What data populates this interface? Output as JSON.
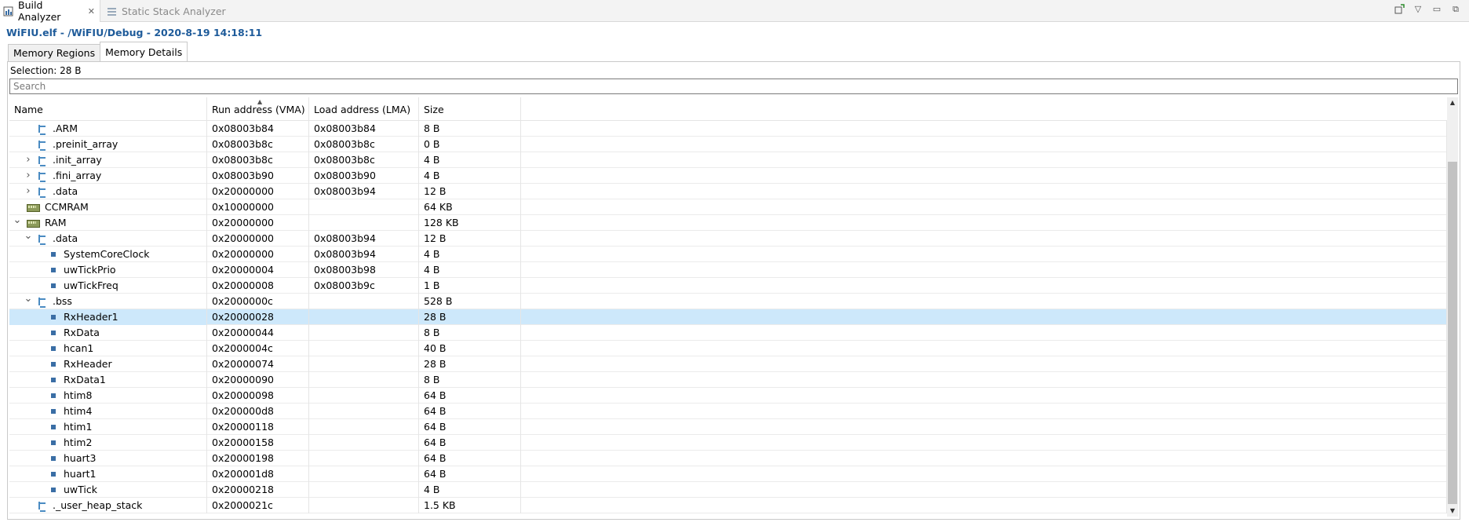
{
  "view_tabs": [
    {
      "label": "Build Analyzer",
      "active": true
    },
    {
      "label": "Static Stack Analyzer",
      "active": false
    }
  ],
  "elf_title": "WiFIU.elf - /WiFIU/Debug - 2020-8-19 14:18:11",
  "inner_tabs": [
    "Memory Regions",
    "Memory Details"
  ],
  "selection_text": "Selection: 28 B",
  "search": {
    "placeholder": "Search",
    "value": ""
  },
  "columns": [
    "Name",
    "Run address (VMA)",
    "Load address (LMA)",
    "Size"
  ],
  "rows": [
    {
      "name": ".ARM",
      "vma": "0x08003b84",
      "lma": "0x08003b84",
      "size": "8 B",
      "depth": 1,
      "twisty": "",
      "icon": "section"
    },
    {
      "name": ".preinit_array",
      "vma": "0x08003b8c",
      "lma": "0x08003b8c",
      "size": "0 B",
      "depth": 1,
      "twisty": "",
      "icon": "section"
    },
    {
      "name": ".init_array",
      "vma": "0x08003b8c",
      "lma": "0x08003b8c",
      "size": "4 B",
      "depth": 1,
      "twisty": "collapsed",
      "icon": "section"
    },
    {
      "name": ".fini_array",
      "vma": "0x08003b90",
      "lma": "0x08003b90",
      "size": "4 B",
      "depth": 1,
      "twisty": "collapsed",
      "icon": "section"
    },
    {
      "name": ".data",
      "vma": "0x20000000",
      "lma": "0x08003b94",
      "size": "12 B",
      "depth": 1,
      "twisty": "collapsed",
      "icon": "section"
    },
    {
      "name": "CCMRAM",
      "vma": "0x10000000",
      "lma": "",
      "size": "64 KB",
      "depth": 0,
      "twisty": "",
      "icon": "memory"
    },
    {
      "name": "RAM",
      "vma": "0x20000000",
      "lma": "",
      "size": "128 KB",
      "depth": 0,
      "twisty": "expanded",
      "icon": "memory"
    },
    {
      "name": ".data",
      "vma": "0x20000000",
      "lma": "0x08003b94",
      "size": "12 B",
      "depth": 1,
      "twisty": "expanded",
      "icon": "section"
    },
    {
      "name": "SystemCoreClock",
      "vma": "0x20000000",
      "lma": "0x08003b94",
      "size": "4 B",
      "depth": 2,
      "twisty": "",
      "icon": "symbol"
    },
    {
      "name": "uwTickPrio",
      "vma": "0x20000004",
      "lma": "0x08003b98",
      "size": "4 B",
      "depth": 2,
      "twisty": "",
      "icon": "symbol"
    },
    {
      "name": "uwTickFreq",
      "vma": "0x20000008",
      "lma": "0x08003b9c",
      "size": "1 B",
      "depth": 2,
      "twisty": "",
      "icon": "symbol"
    },
    {
      "name": ".bss",
      "vma": "0x2000000c",
      "lma": "",
      "size": "528 B",
      "depth": 1,
      "twisty": "expanded",
      "icon": "section"
    },
    {
      "name": "RxHeader1",
      "vma": "0x20000028",
      "lma": "",
      "size": "28 B",
      "depth": 2,
      "twisty": "",
      "icon": "symbol",
      "selected": true
    },
    {
      "name": "RxData",
      "vma": "0x20000044",
      "lma": "",
      "size": "8 B",
      "depth": 2,
      "twisty": "",
      "icon": "symbol"
    },
    {
      "name": "hcan1",
      "vma": "0x2000004c",
      "lma": "",
      "size": "40 B",
      "depth": 2,
      "twisty": "",
      "icon": "symbol"
    },
    {
      "name": "RxHeader",
      "vma": "0x20000074",
      "lma": "",
      "size": "28 B",
      "depth": 2,
      "twisty": "",
      "icon": "symbol"
    },
    {
      "name": "RxData1",
      "vma": "0x20000090",
      "lma": "",
      "size": "8 B",
      "depth": 2,
      "twisty": "",
      "icon": "symbol"
    },
    {
      "name": "htim8",
      "vma": "0x20000098",
      "lma": "",
      "size": "64 B",
      "depth": 2,
      "twisty": "",
      "icon": "symbol"
    },
    {
      "name": "htim4",
      "vma": "0x200000d8",
      "lma": "",
      "size": "64 B",
      "depth": 2,
      "twisty": "",
      "icon": "symbol"
    },
    {
      "name": "htim1",
      "vma": "0x20000118",
      "lma": "",
      "size": "64 B",
      "depth": 2,
      "twisty": "",
      "icon": "symbol"
    },
    {
      "name": "htim2",
      "vma": "0x20000158",
      "lma": "",
      "size": "64 B",
      "depth": 2,
      "twisty": "",
      "icon": "symbol"
    },
    {
      "name": "huart3",
      "vma": "0x20000198",
      "lma": "",
      "size": "64 B",
      "depth": 2,
      "twisty": "",
      "icon": "symbol"
    },
    {
      "name": "huart1",
      "vma": "0x200001d8",
      "lma": "",
      "size": "64 B",
      "depth": 2,
      "twisty": "",
      "icon": "symbol"
    },
    {
      "name": "uwTick",
      "vma": "0x20000218",
      "lma": "",
      "size": "4 B",
      "depth": 2,
      "twisty": "",
      "icon": "symbol"
    },
    {
      "name": "._user_heap_stack",
      "vma": "0x2000021c",
      "lma": "",
      "size": "1.5 KB",
      "depth": 1,
      "twisty": "",
      "icon": "section"
    }
  ]
}
